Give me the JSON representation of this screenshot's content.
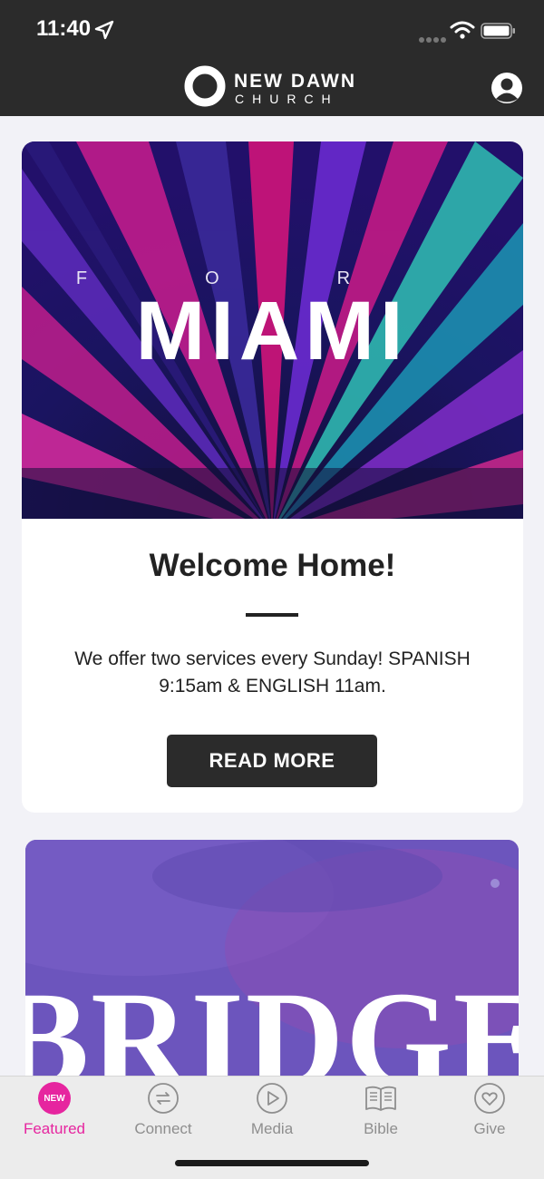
{
  "status_bar": {
    "time": "11:40"
  },
  "header": {
    "logo_line1": "NEW DAWN",
    "logo_line2": "CHURCH",
    "profile_icon": "person-circle-icon"
  },
  "featured_card": {
    "image_text_small": "F O R",
    "image_text_big": "MIAMI",
    "title": "Welcome Home!",
    "body": "We offer two services every Sunday! SPANISH 9:15am & ENGLISH 11am.",
    "button_label": "READ MORE"
  },
  "second_card": {
    "image_text": "BRIDGE"
  },
  "tabs": [
    {
      "label": "Featured",
      "icon": "new-badge-icon",
      "badge": "NEW",
      "active": true
    },
    {
      "label": "Connect",
      "icon": "connect-arrows-icon",
      "active": false
    },
    {
      "label": "Media",
      "icon": "play-circle-icon",
      "active": false
    },
    {
      "label": "Bible",
      "icon": "book-icon",
      "active": false
    },
    {
      "label": "Give",
      "icon": "heart-circle-icon",
      "active": false
    }
  ],
  "colors": {
    "header_bg": "#2b2b2b",
    "accent": "#e6259f",
    "inactive_tab": "#8e8e8e"
  }
}
